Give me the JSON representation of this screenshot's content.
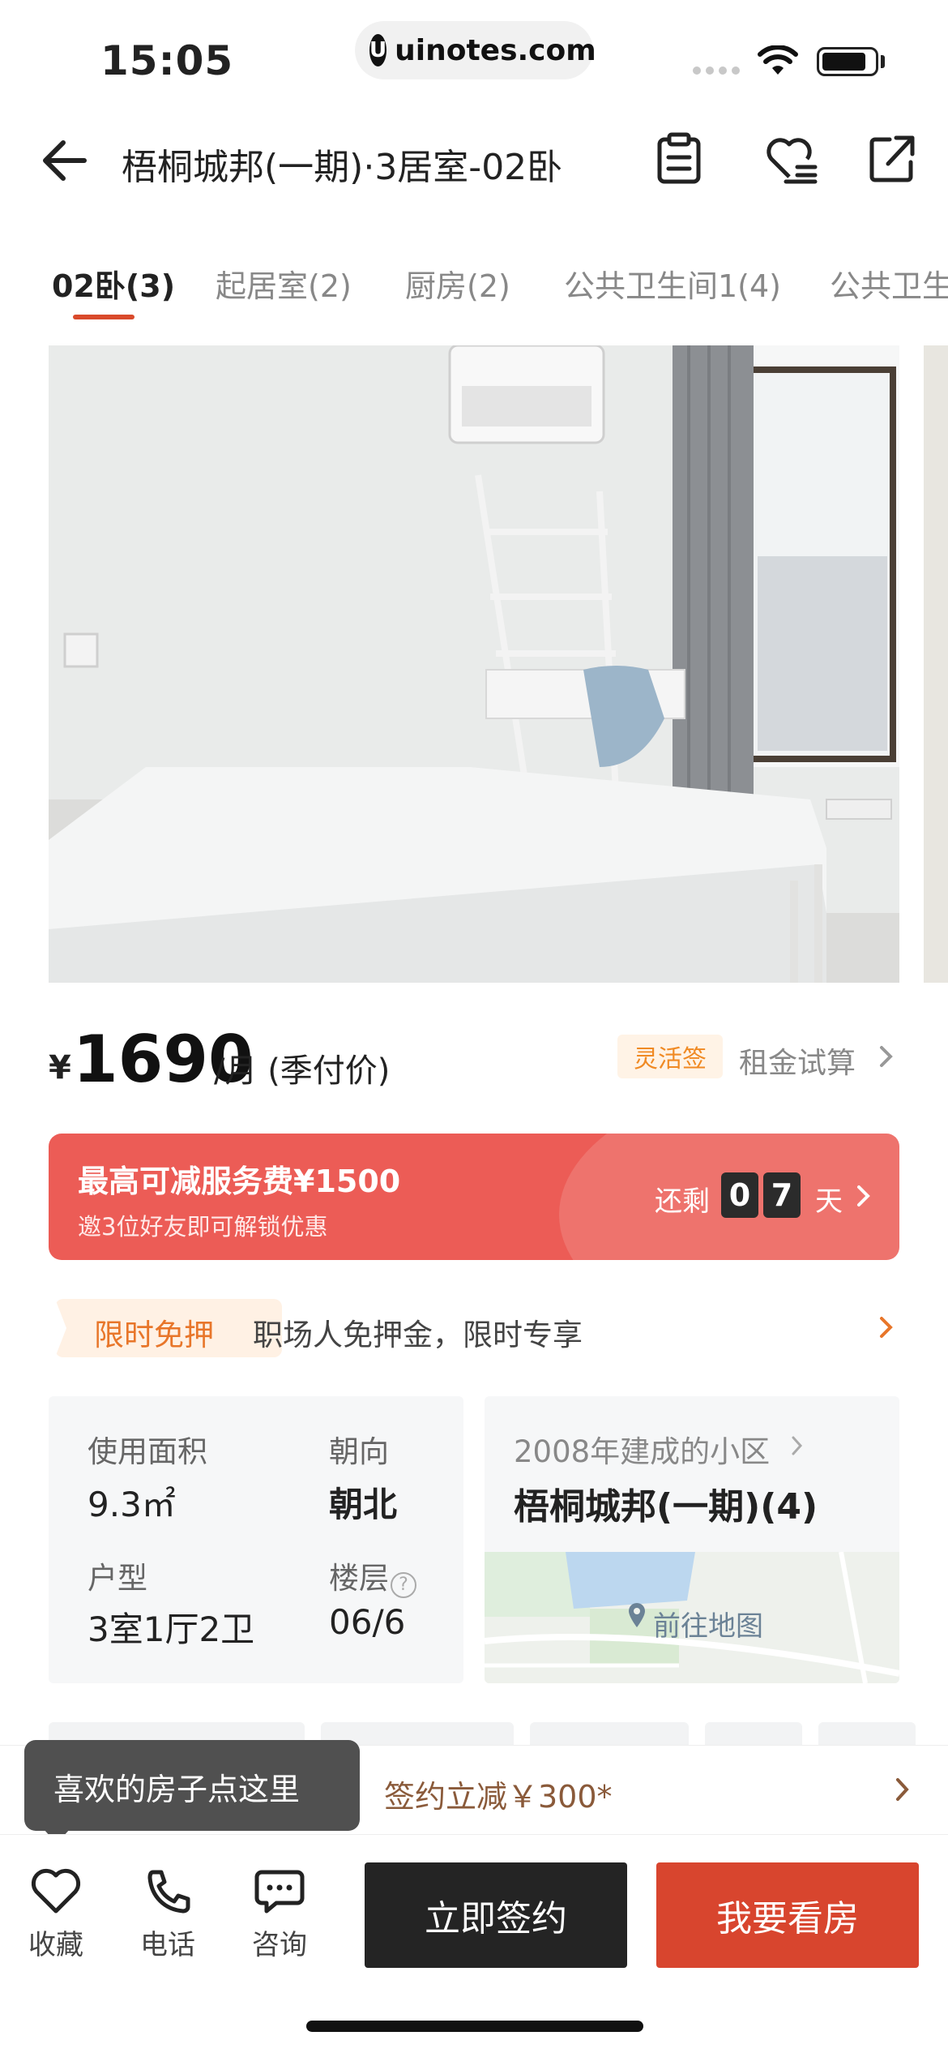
{
  "status_bar": {
    "time": "15:05",
    "url": "uinotes.com"
  },
  "header": {
    "title": "梧桐城邦(一期)·3居室-02卧"
  },
  "tabs": [
    {
      "label": "02卧(3)",
      "active": true
    },
    {
      "label": "起居室(2)",
      "active": false
    },
    {
      "label": "厨房(2)",
      "active": false
    },
    {
      "label": "公共卫生间1(4)",
      "active": false
    },
    {
      "label": "公共卫生",
      "active": false
    }
  ],
  "price": {
    "currency": "¥",
    "amount": "1690",
    "unit": "/月 (季付价)",
    "flex_tag": "灵活签",
    "calc_link": "租金试算"
  },
  "promo": {
    "title": "最高可减服务费¥1500",
    "subtitle": "邀3位好友即可解锁优惠",
    "remain_label": "还剩",
    "digits": [
      "0",
      "7"
    ],
    "day_label": "天"
  },
  "deposit": {
    "tag": "限时免押",
    "text": "职场人免押金，限时专享"
  },
  "info": {
    "area_label": "使用面积",
    "area_value": "9.3㎡",
    "orientation_label": "朝向",
    "orientation_value": "朝北",
    "layout_label": "户型",
    "layout_value": "3室1厅2卫",
    "floor_label": "楼层",
    "floor_value": "06/6"
  },
  "community": {
    "built": "2008年建成的小区",
    "name": "梧桐城邦(一期)(4)",
    "map_link": "前往地图"
  },
  "sign_bar": {
    "text": "签约立减￥300*"
  },
  "tooltip": {
    "text": "喜欢的房子点这里"
  },
  "bottom_bar": {
    "favorite": "收藏",
    "phone": "电话",
    "consult": "咨询",
    "sign_button": "立即签约",
    "view_button": "我要看房"
  },
  "colors": {
    "accent": "#d8452e",
    "promo_bg": "#ec5c56",
    "tag_orange": "#f08a24",
    "dark_button": "#242424"
  }
}
